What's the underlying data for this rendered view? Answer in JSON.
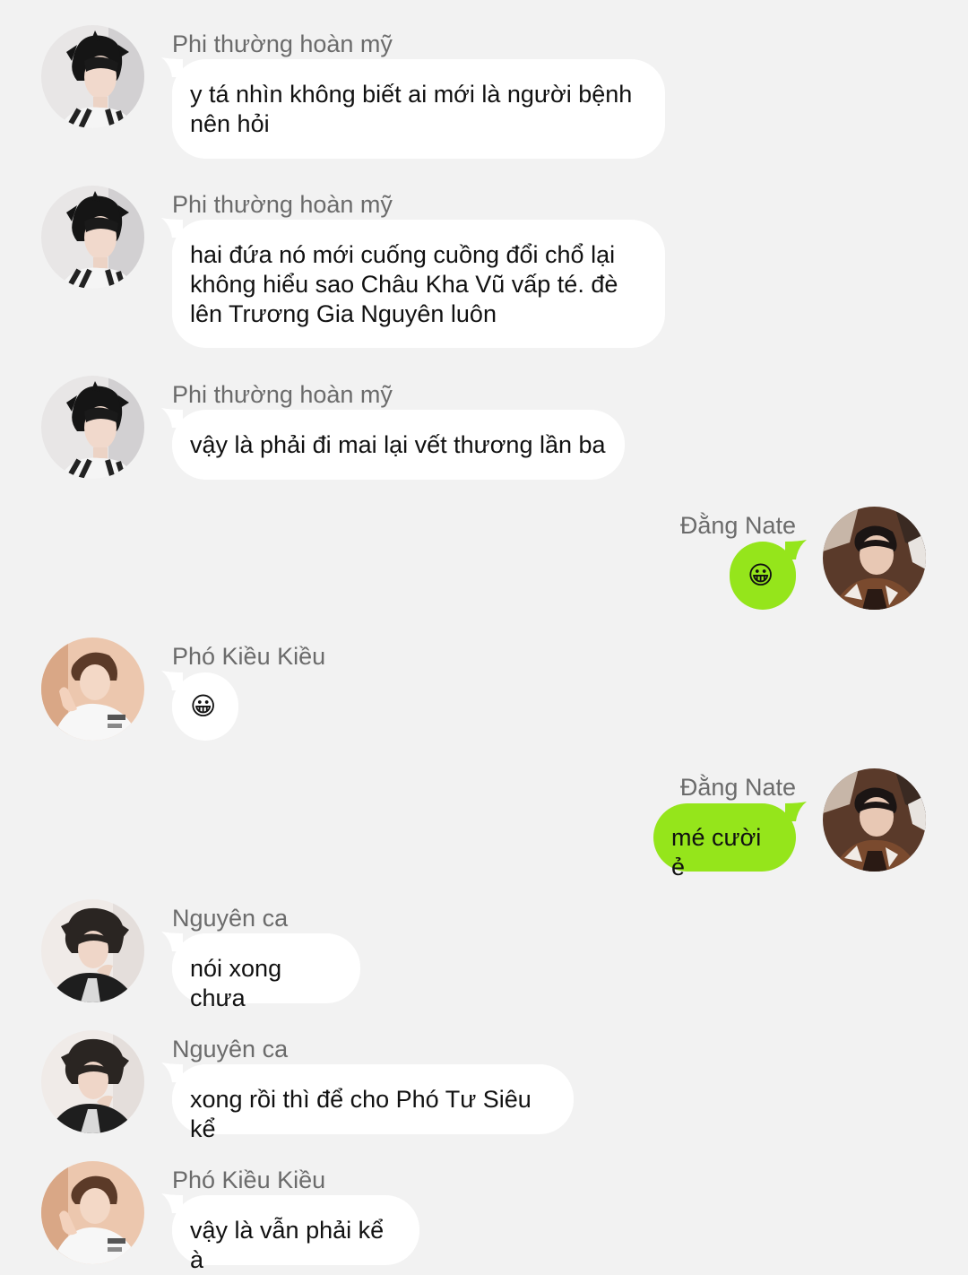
{
  "colors": {
    "background": "#f2f2f2",
    "incoming_bubble": "#ffffff",
    "outgoing_bubble": "#95e51b",
    "sender_name": "#6b6b6b"
  },
  "messages": [
    {
      "sender": "Phi thường hoàn mỹ",
      "text": "y tá nhìn không biết ai mới là người bệnh\nnên hỏi",
      "direction": "incoming",
      "avatar": "avatar-phi-icon"
    },
    {
      "sender": "Phi thường hoàn mỹ",
      "text": "hai đứa nó mới cuống cuồng đổi chổ lại\nkhông hiểu sao Châu Kha Vũ vấp té. đè\nlên Trương Gia Nguyên luôn",
      "direction": "incoming",
      "avatar": "avatar-phi-icon"
    },
    {
      "sender": "Phi thường hoàn mỹ",
      "text": "vậy là phải đi mai lại vết thương lần ba",
      "direction": "incoming",
      "avatar": "avatar-phi-icon"
    },
    {
      "sender": "Đằng Nate",
      "text": "😀",
      "direction": "outgoing",
      "avatar": "avatar-nate-icon"
    },
    {
      "sender": "Phó Kiều Kiều",
      "text": "😀",
      "direction": "incoming",
      "avatar": "avatar-pho-icon"
    },
    {
      "sender": "Đằng Nate",
      "text": "mé cười ẻ",
      "direction": "outgoing",
      "avatar": "avatar-nate-icon"
    },
    {
      "sender": "Nguyên ca",
      "text": "nói xong chưa",
      "direction": "incoming",
      "avatar": "avatar-nguyen-icon"
    },
    {
      "sender": "Nguyên ca",
      "text": "xong rồi thì để cho Phó Tư Siêu kể",
      "direction": "incoming",
      "avatar": "avatar-nguyen-icon"
    },
    {
      "sender": "Phó Kiều Kiều",
      "text": "vậy là vẫn phải kể à",
      "direction": "incoming",
      "avatar": "avatar-pho-icon"
    }
  ]
}
